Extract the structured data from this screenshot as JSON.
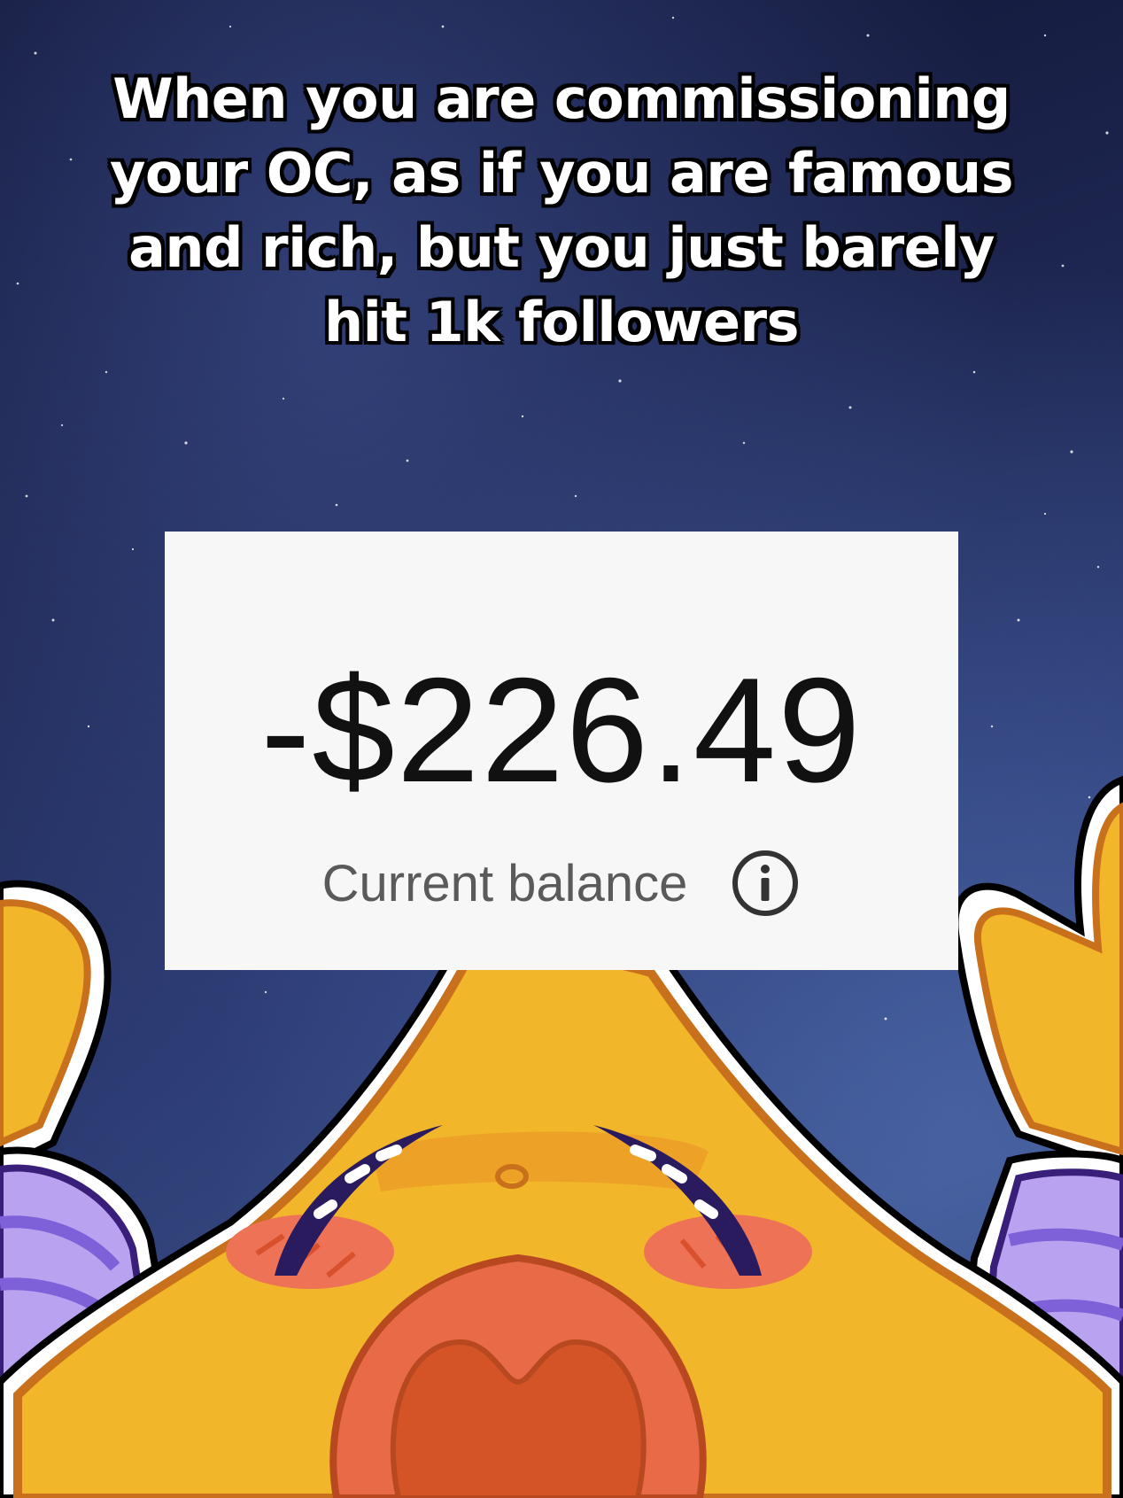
{
  "caption": {
    "line1": "When you are commissioning",
    "line2": "your OC, as if you are famous",
    "line3": "and rich, but you just barely",
    "line4": "hit 1k followers"
  },
  "balance_card": {
    "amount": "-$226.49",
    "label": "Current balance",
    "info_icon": "info-icon"
  },
  "colors": {
    "star_yellow": "#f2b62a",
    "sleeve_purple": "#b9a3f0",
    "mouth_orange": "#e86a46",
    "blush": "#ee7255",
    "sky_dark": "#141a3c"
  }
}
